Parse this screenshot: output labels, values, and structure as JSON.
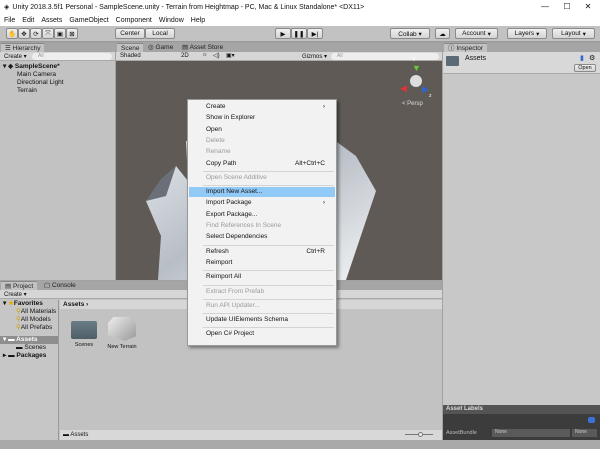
{
  "window": {
    "title": "Unity 2018.3.5f1 Personal - SampleScene.unity - Terrain from Heightmap - PC, Mac & Linux Standalone* <DX11>",
    "minimize": "—",
    "maximize": "☐",
    "close": "✕"
  },
  "menu": [
    "File",
    "Edit",
    "Assets",
    "GameObject",
    "Component",
    "Window",
    "Help"
  ],
  "toolbar": {
    "center": "Center",
    "local": "Local",
    "collab": "Collab ▾",
    "account": "Account",
    "layers": "Layers",
    "layout": "Layout"
  },
  "hierarchy": {
    "tab": "Hierarchy",
    "create": "Create ▾",
    "search_placeholder": "All",
    "scene": "SampleScene*",
    "items": [
      "Main Camera",
      "Directional Light",
      "Terrain"
    ]
  },
  "scene": {
    "tabs": [
      "Scene",
      "Game",
      "Asset Store"
    ],
    "shading": "Shaded",
    "mode2d": "2D",
    "gizmos": "Gizmos ▾",
    "search_placeholder": "All",
    "persp": "< Persp",
    "axes": {
      "y": "y",
      "x": "x",
      "z": "z"
    }
  },
  "context_menu": [
    {
      "label": "Create",
      "submenu": true
    },
    {
      "label": "Show in Explorer"
    },
    {
      "label": "Open"
    },
    {
      "label": "Delete",
      "disabled": true
    },
    {
      "label": "Rename",
      "disabled": true
    },
    {
      "label": "Copy Path",
      "shortcut": "Alt+Ctrl+C"
    },
    {
      "sep": true
    },
    {
      "label": "Open Scene Additive",
      "disabled": true
    },
    {
      "sep": true
    },
    {
      "label": "Import New Asset...",
      "highlighted": true
    },
    {
      "label": "Import Package",
      "submenu": true
    },
    {
      "label": "Export Package..."
    },
    {
      "label": "Find References In Scene",
      "disabled": true
    },
    {
      "label": "Select Dependencies"
    },
    {
      "sep": true
    },
    {
      "label": "Refresh",
      "shortcut": "Ctrl+R"
    },
    {
      "label": "Reimport"
    },
    {
      "sep": true
    },
    {
      "label": "Reimport All"
    },
    {
      "sep": true
    },
    {
      "label": "Extract From Prefab",
      "disabled": true
    },
    {
      "sep": true
    },
    {
      "label": "Run API Updater...",
      "disabled": true
    },
    {
      "sep": true
    },
    {
      "label": "Update UIElements Schema"
    },
    {
      "sep": true
    },
    {
      "label": "Open C# Project"
    }
  ],
  "inspector": {
    "tab": "Inspector",
    "asset_name": "Assets",
    "open": "Open",
    "labels_header": "Asset Labels",
    "assetbundle_label": "AssetBundle",
    "bundle_value": "None",
    "variant_value": "None"
  },
  "project": {
    "tabs": [
      "Project",
      "Console"
    ],
    "create": "Create ▾",
    "favorites": "Favorites",
    "fav_items": [
      "All Materials",
      "All Models",
      "All Prefabs"
    ],
    "assets": "Assets",
    "asset_children": [
      "Scenes"
    ],
    "packages": "Packages",
    "breadcrumb": "Assets",
    "grid_items": [
      "Scenes",
      "New Terrain"
    ],
    "footer": "Assets"
  }
}
